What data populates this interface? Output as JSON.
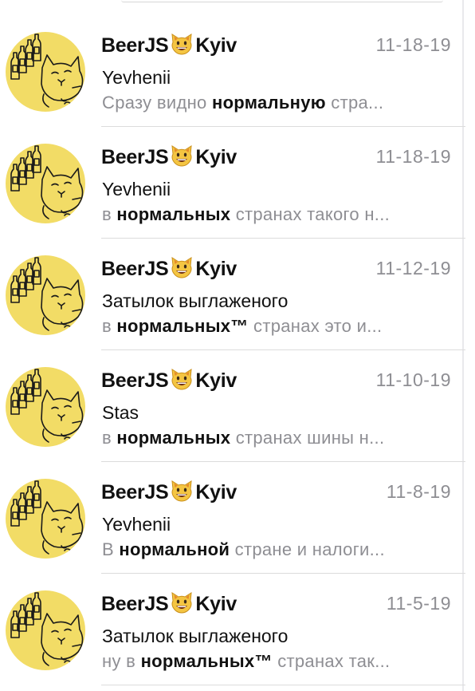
{
  "colors": {
    "avatar": "#f2dc66",
    "muted": "#8e8e93",
    "text": "#111111"
  },
  "avatar_icon": "beer-cat-icon",
  "name_icon": "grinning-cat-emoji-icon",
  "messages": [
    {
      "name_left": "BeerJS",
      "name_right": "Kyiv",
      "date": "11-18-19",
      "sender": "Yevhenii",
      "preview_before": "Сразу видно ",
      "preview_bold": "нормальную",
      "preview_after": " стра..."
    },
    {
      "name_left": "BeerJS",
      "name_right": "Kyiv",
      "date": "11-18-19",
      "sender": "Yevhenii",
      "preview_before": "в ",
      "preview_bold": "нормальных",
      "preview_after": " странах такого н..."
    },
    {
      "name_left": "BeerJS",
      "name_right": "Kyiv",
      "date": "11-12-19",
      "sender": "Затылок выглаженого",
      "preview_before": "в ",
      "preview_bold": "нормальных™",
      "preview_after": " странах это и..."
    },
    {
      "name_left": "BeerJS",
      "name_right": "Kyiv",
      "date": "11-10-19",
      "sender": "Stas",
      "preview_before": "в ",
      "preview_bold": "нормальных",
      "preview_after": " странах шины н..."
    },
    {
      "name_left": "BeerJS",
      "name_right": "Kyiv",
      "date": "11-8-19",
      "sender": "Yevhenii",
      "preview_before": "В ",
      "preview_bold": "нормальной",
      "preview_after": " стране и налоги..."
    },
    {
      "name_left": "BeerJS",
      "name_right": "Kyiv",
      "date": "11-5-19",
      "sender": "Затылок выглаженого",
      "preview_before": "ну в ",
      "preview_bold": "нормальных™",
      "preview_after": " странах так..."
    }
  ]
}
